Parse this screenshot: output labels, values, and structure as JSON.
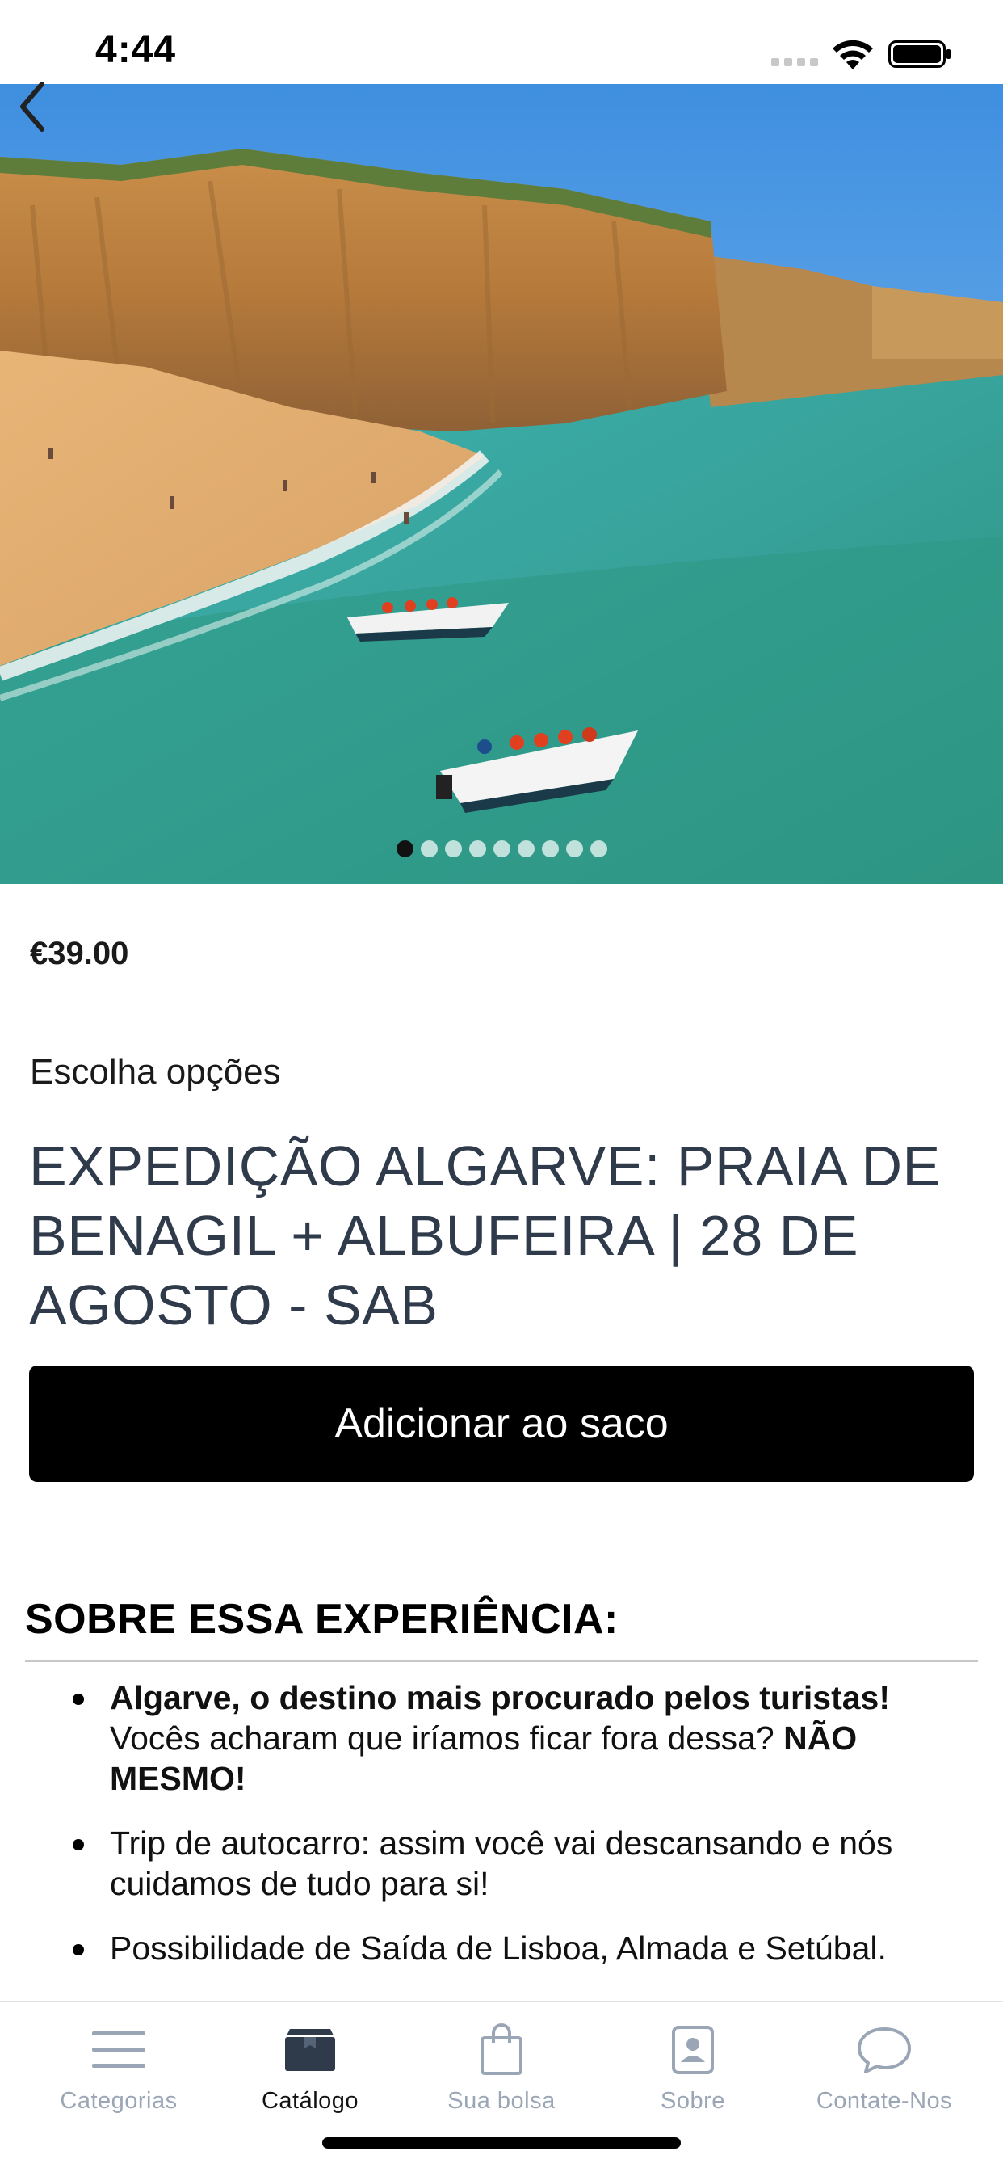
{
  "status_bar": {
    "time": "4:44"
  },
  "hero": {
    "slide_count": 9,
    "active_slide": 1
  },
  "product": {
    "price": "€39.00",
    "options_label": "Escolha opções",
    "title": "EXPEDIÇÃO ALGARVE: PRAIA DE BENAGIL + ALBUFEIRA | 28 DE AGOSTO - SAB",
    "add_button_label": "Adicionar ao saco"
  },
  "about": {
    "heading": "SOBRE ESSA EXPERIÊNCIA:",
    "item1_bold": "Algarve, o destino mais procurado pelos turistas!",
    "item1_text": " Vocês acharam que iríamos ficar fora dessa? ",
    "item1_bold2": "NÃO MESMO!",
    "item2": "Trip de autocarro: assim você vai descansando e nós cuidamos de tudo para si!",
    "item3": "Possibilidade de Saída de Lisboa, Almada e Setúbal."
  },
  "tab_bar": {
    "tabs": [
      {
        "label": "Categorias",
        "icon": "menu-lines-icon",
        "active": false
      },
      {
        "label": "Catálogo",
        "icon": "box-icon",
        "active": true
      },
      {
        "label": "Sua bolsa",
        "icon": "shopping-bag-icon",
        "active": false
      },
      {
        "label": "Sobre",
        "icon": "contact-card-icon",
        "active": false
      },
      {
        "label": "Contate-Nos",
        "icon": "chat-bubble-icon",
        "active": false
      }
    ]
  },
  "colors": {
    "title_text": "#2f3a4b",
    "tab_inactive": "#9aa6b6",
    "tab_active": "#111111",
    "button_bg": "#000000"
  }
}
